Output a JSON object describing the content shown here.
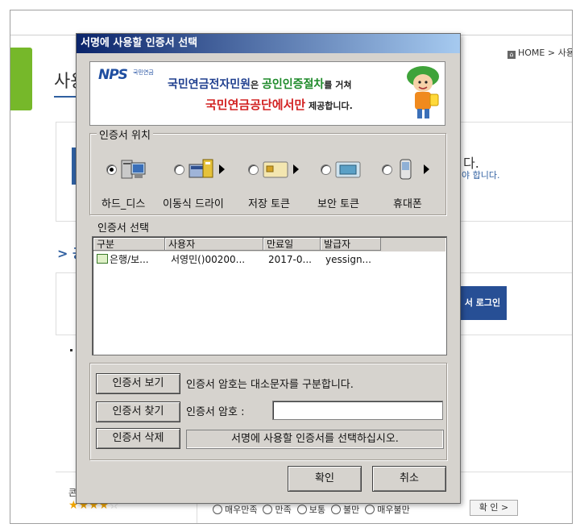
{
  "background": {
    "page_title": "사용",
    "breadcrumb_home": "HOME",
    "breadcrumb_sep": ">",
    "breadcrumb_next": "사용",
    "right_text_1": "다.",
    "right_text_2": "야 합니다.",
    "section_arrow": "> 공",
    "login_button": "서 로그인",
    "bottom_label": "콘",
    "satisfaction_options": [
      "매우만족",
      "만족",
      "보통",
      "불만",
      "매우불만"
    ],
    "confirm_button": "확 인",
    "confirm_arrow": ">",
    "rating": 4,
    "rating_max": 5
  },
  "dialog": {
    "title": "서명에 사용할 인증서 선택",
    "banner": {
      "logo": "NPS",
      "logo_sub": "국민연금",
      "line1_a": "국민연금전자민원",
      "line1_b": "은 ",
      "line1_c": "공인인증절차",
      "line1_d": "를 거쳐",
      "line2_a": "국민연금공단에서만",
      "line2_b": " 제공합니다."
    },
    "location_group_label": "인증서 위치",
    "locations": [
      {
        "label": "하드_디스",
        "icon": "hard-disk-icon",
        "checked": true
      },
      {
        "label": "이동식 드라이",
        "icon": "removable-drive-icon",
        "checked": false
      },
      {
        "label": "저장 토큰",
        "icon": "storage-token-icon",
        "checked": false
      },
      {
        "label": "보안 토큰",
        "icon": "security-token-icon",
        "checked": false
      },
      {
        "label": "휴대폰",
        "icon": "mobile-phone-icon",
        "checked": false
      }
    ],
    "cert_list_label": "인증서 선택",
    "columns": [
      "구분",
      "사용자",
      "만료일",
      "발급자"
    ],
    "rows": [
      {
        "type": "은행/보...",
        "user": "서영민()00200...",
        "expiry": "2017-0...",
        "issuer": "yessign..."
      }
    ],
    "buttons": {
      "view": "인증서 보기",
      "find": "인증서 찾기",
      "delete": "인증서 삭제",
      "ok": "확인",
      "cancel": "취소"
    },
    "case_note": "인증서 암호는 대소문자를 구분합니다.",
    "password_label": "인증서 암호 :",
    "password_value": "",
    "status_message": "서명에 사용할 인증서를 선택하십시오."
  }
}
